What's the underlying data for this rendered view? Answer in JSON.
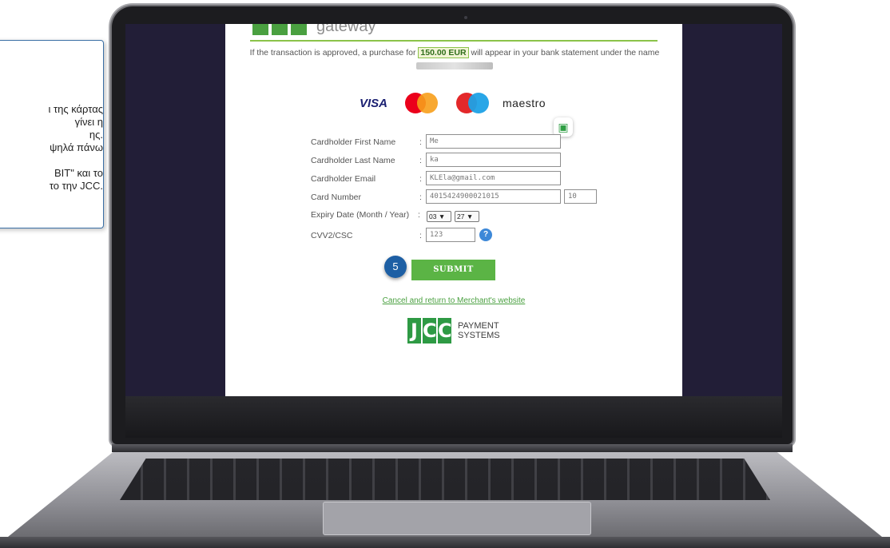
{
  "callout": {
    "lines": [
      "ι της κάρτας",
      "γίνει η",
      "ης.",
      "ψηλά πάνω",
      "",
      "BIT\"  και το",
      "το την JCC."
    ]
  },
  "payment_page": {
    "gateway_label": "gateway",
    "notice_before": "If the transaction is approved, a purchase for",
    "amount": "150.00 EUR",
    "notice_after": "will appear in your bank statement under the name",
    "brands": {
      "visa": "VISA",
      "maestro": "maestro"
    },
    "form": {
      "first_name_label": "Cardholder First Name",
      "last_name_label": "Cardholder Last Name",
      "email_label": "Cardholder Email",
      "card_number_label": "Card Number",
      "expiry_label": "Expiry Date (Month / Year)",
      "cvv_label": "CVV2/CSC",
      "first_name_value": "Me",
      "last_name_value": "ka",
      "email_value": "KLEla@gmail.com",
      "card_number_value": "4015424900021015",
      "card_number_suffix": "10",
      "expiry_month": "03",
      "expiry_year": "27",
      "cvv_value": "123"
    },
    "submit_label": "SUBMIT",
    "step_number": "5",
    "cancel_link": "Cancel and return to Merchant's website",
    "jcc": {
      "letters": [
        "J",
        "C",
        "C"
      ],
      "line1": "PAYMENT",
      "line2": "SYSTEMS"
    }
  },
  "colors": {
    "accent_green": "#5bb445",
    "step_blue": "#1d5fa4",
    "screen_bg": "#221e37"
  }
}
